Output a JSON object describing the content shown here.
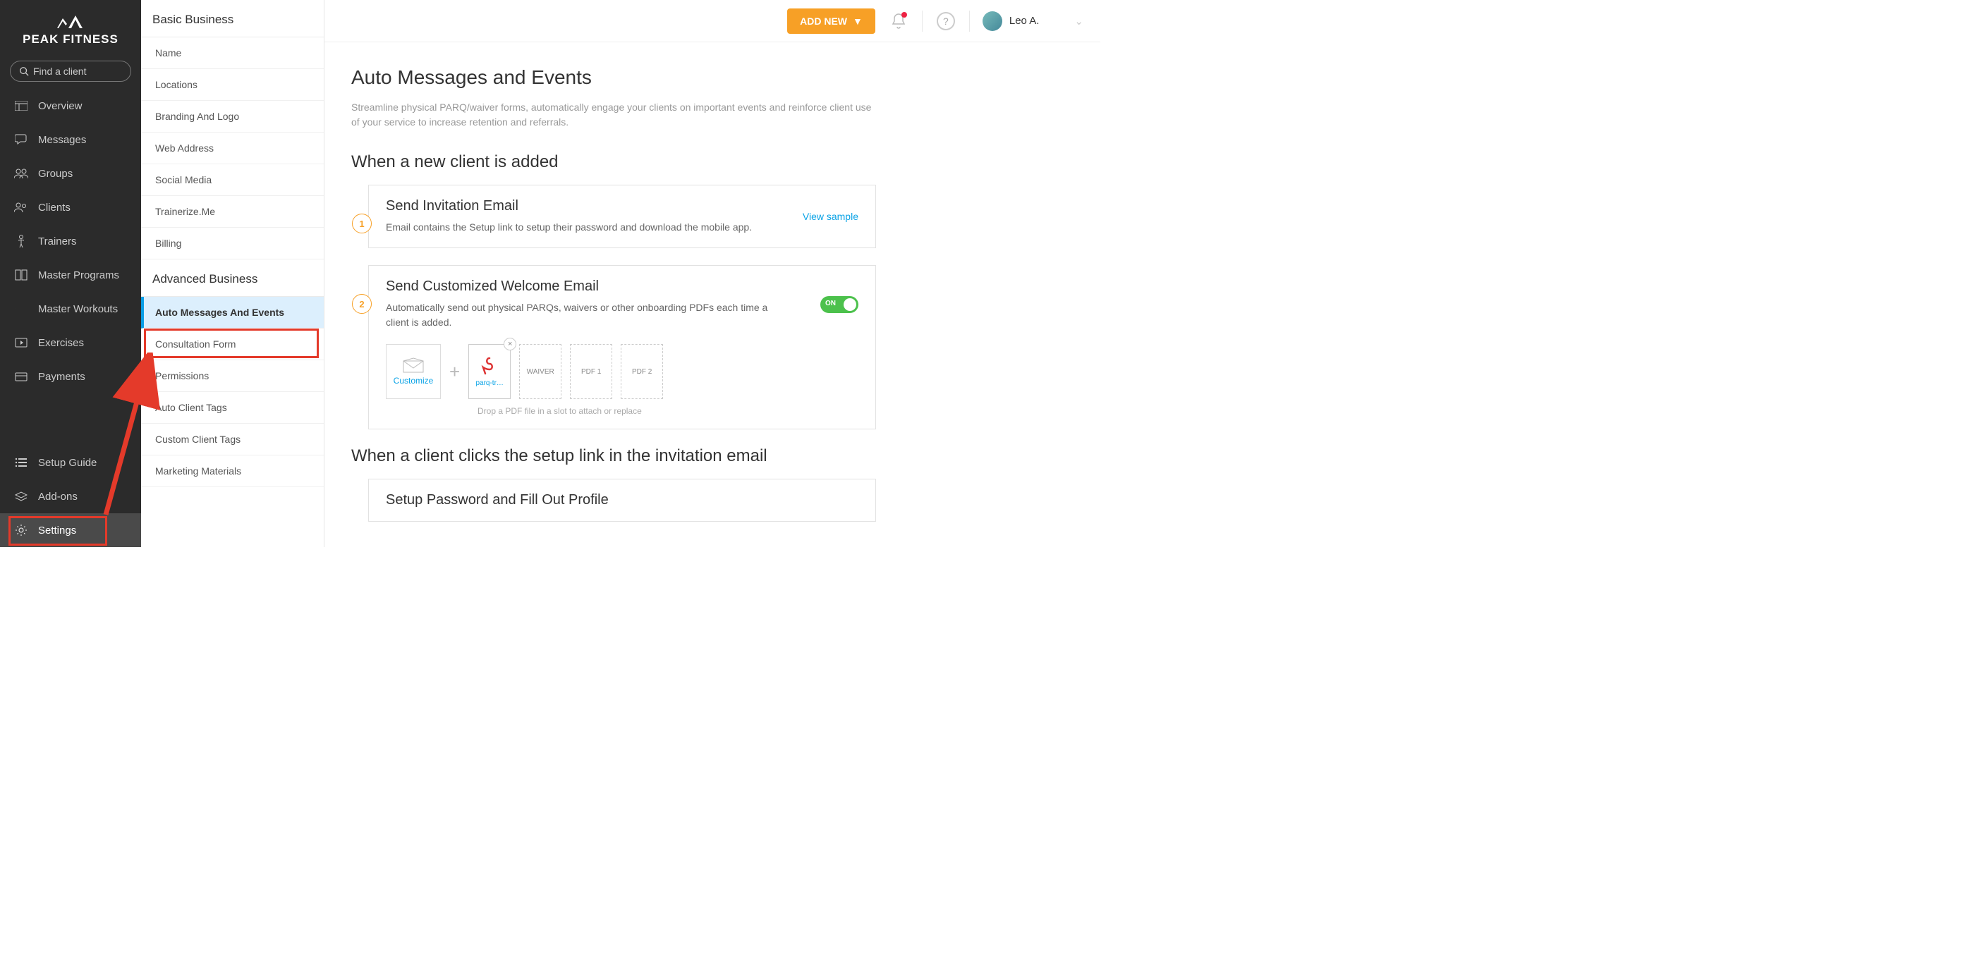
{
  "brand": {
    "name": "PEAK FITNESS"
  },
  "search": {
    "placeholder": "Find a client"
  },
  "topbar": {
    "addnew_label": "ADD NEW",
    "username": "Leo A."
  },
  "sidebar": {
    "items": [
      {
        "label": "Overview"
      },
      {
        "label": "Messages"
      },
      {
        "label": "Groups"
      },
      {
        "label": "Clients"
      },
      {
        "label": "Trainers"
      },
      {
        "label": "Master Programs"
      },
      {
        "label": "Master Workouts"
      },
      {
        "label": "Exercises"
      },
      {
        "label": "Payments"
      }
    ],
    "bottom": [
      {
        "label": "Setup Guide"
      },
      {
        "label": "Add-ons"
      },
      {
        "label": "Settings"
      }
    ]
  },
  "subsidebar": {
    "section1_title": "Basic Business",
    "section1_items": [
      {
        "label": "Name"
      },
      {
        "label": "Locations"
      },
      {
        "label": "Branding And Logo"
      },
      {
        "label": "Web Address"
      },
      {
        "label": "Social Media"
      },
      {
        "label": "Trainerize.Me"
      },
      {
        "label": "Billing"
      }
    ],
    "section2_title": "Advanced Business",
    "section2_items": [
      {
        "label": "Auto Messages And Events",
        "active": true
      },
      {
        "label": "Consultation Form"
      },
      {
        "label": "Permissions"
      },
      {
        "label": "Auto Client Tags"
      },
      {
        "label": "Custom Client Tags"
      },
      {
        "label": "Marketing Materials"
      }
    ]
  },
  "page": {
    "title": "Auto Messages and Events",
    "subtitle": "Streamline physical PARQ/waiver forms, automatically engage your clients on important events and reinforce client use of your service to increase retention and referrals.",
    "section1_title": "When a new client is added",
    "card1": {
      "num": "1",
      "title": "Send Invitation Email",
      "desc": "Email contains the Setup link to setup their password and download the mobile app.",
      "view_sample": "View sample"
    },
    "card2": {
      "num": "2",
      "title": "Send Customized Welcome Email",
      "desc": "Automatically send out physical PARQs, waivers or other onboarding PDFs each time a client is added.",
      "toggle_label": "ON",
      "customize_label": "Customize",
      "slot1_label": "parq-tr…",
      "slot2_label": "WAIVER",
      "slot3_label": "PDF 1",
      "slot4_label": "PDF 2",
      "drop_hint": "Drop a PDF file in a slot to attach or replace"
    },
    "section2_title": "When a client clicks the setup link in the invitation email",
    "card3_title": "Setup Password and Fill Out Profile"
  }
}
